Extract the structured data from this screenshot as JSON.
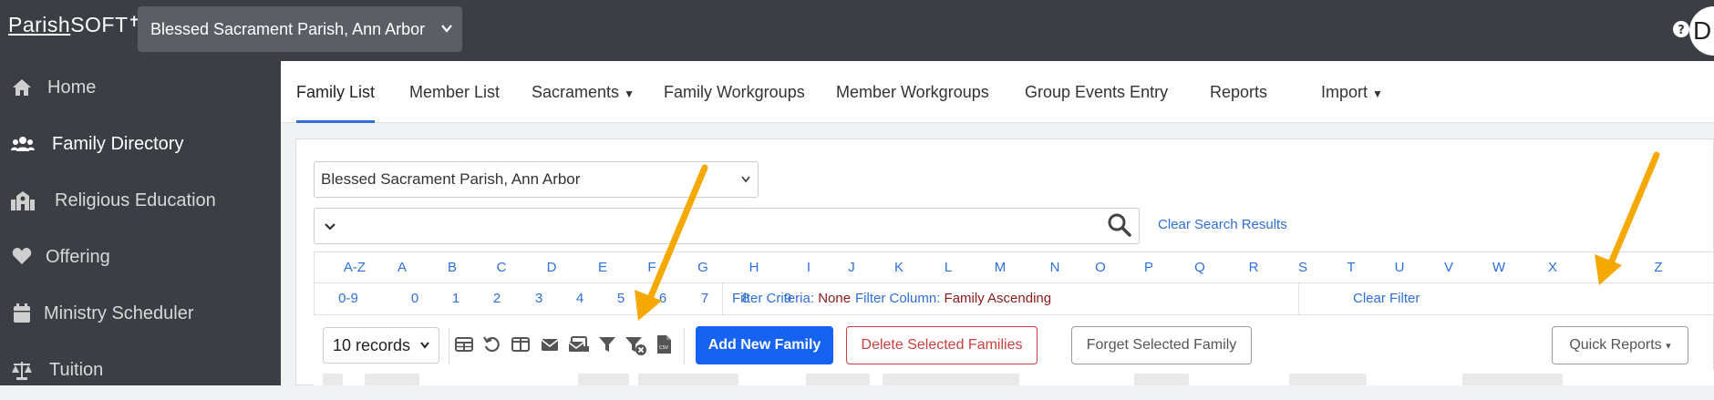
{
  "topbar": {
    "logo_part1": "Parish",
    "logo_part2": "SOFT",
    "parish_selector": "Blessed Sacrament Parish, Ann Arbor",
    "help_icon": "question-circle-icon",
    "phone_icon": "phone-icon",
    "avatar_initial": "D"
  },
  "sidebar": {
    "items": [
      {
        "label": "Home",
        "icon": "home-icon"
      },
      {
        "label": "Family Directory",
        "icon": "users-icon"
      },
      {
        "label": "Religious Education",
        "icon": "school-icon"
      },
      {
        "label": "Offering",
        "icon": "heart-icon"
      },
      {
        "label": "Ministry Scheduler",
        "icon": "calendar-icon"
      },
      {
        "label": "Tuition",
        "icon": "scale-icon"
      }
    ]
  },
  "tabs": {
    "family_list": "Family List",
    "member_list": "Member List",
    "sacraments": "Sacraments",
    "family_workgroups": "Family Workgroups",
    "member_workgroups": "Member Workgroups",
    "group_events_entry": "Group Events Entry",
    "reports": "Reports",
    "import": "Import"
  },
  "filters": {
    "parish_dropdown": "Blessed Sacrament Parish, Ann Arbor",
    "search_value": "",
    "clear_search": "Clear Search Results",
    "alpha_all": "A-Z",
    "letters": [
      "A",
      "B",
      "C",
      "D",
      "E",
      "F",
      "G",
      "H",
      "I",
      "J",
      "K",
      "L",
      "M",
      "N",
      "O",
      "P",
      "Q",
      "R",
      "S",
      "T",
      "U",
      "V",
      "W",
      "X",
      "Y",
      "Z"
    ],
    "digits_all": "0-9",
    "digits": [
      "0",
      "1",
      "2",
      "3",
      "4",
      "5",
      "6",
      "7",
      "8",
      "9"
    ],
    "filter_criteria_label": "Filter Criteria:",
    "filter_criteria_value": "None",
    "filter_column_label": "Filter Column:",
    "filter_column_value": "Family Ascending",
    "clear_filter": "Clear Filter"
  },
  "toolbar": {
    "records": "10 records",
    "icons": [
      "table-icon",
      "undo-icon",
      "columns-icon",
      "envelope-icon",
      "mail-merge-icon",
      "filter-icon",
      "filter-clear-icon",
      "csv-file-icon"
    ],
    "add_new_family": "Add New Family",
    "delete_selected": "Delete Selected Families",
    "forget_selected": "Forget Selected Family",
    "quick_reports": "Quick Reports"
  },
  "colors": {
    "sidebar_bg": "#3b3f45",
    "link_blue": "#2f6fd8",
    "primary": "#1563f0",
    "danger": "#c94040",
    "annotation_arrow": "#f5a800"
  }
}
